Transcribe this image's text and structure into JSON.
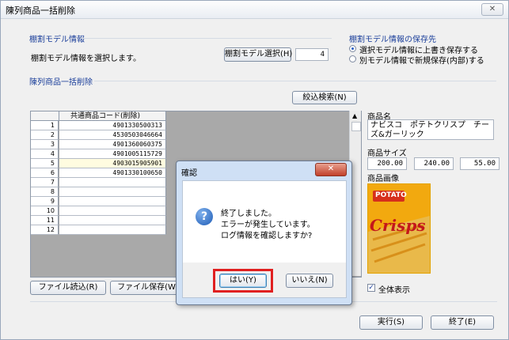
{
  "window": {
    "title": "陳列商品一括削除",
    "close_glyph": "✕"
  },
  "model_info": {
    "group_title": "棚割モデル情報",
    "description": "棚割モデル情報を選択します。",
    "select_button": "棚割モデル選択(H)",
    "count": "4"
  },
  "save_dest": {
    "group_title": "棚割モデル情報の保存先",
    "options": [
      {
        "label": "選択モデル情報に上書き保存する",
        "selected": true
      },
      {
        "label": "別モデル情報で新規保存(内部)する",
        "selected": false
      }
    ]
  },
  "bulk": {
    "group_title": "陳列商品一括削除",
    "filter_button": "絞込検索(N)",
    "grid": {
      "column_header": "共通商品コード(削除)",
      "rows": [
        {
          "no": "1",
          "code": "4901330500313"
        },
        {
          "no": "2",
          "code": "4530503046664"
        },
        {
          "no": "3",
          "code": "4901360060375"
        },
        {
          "no": "4",
          "code": "4901005115729"
        },
        {
          "no": "5",
          "code": "4903015905901"
        },
        {
          "no": "6",
          "code": "4901330100650"
        },
        {
          "no": "7",
          "code": ""
        },
        {
          "no": "8",
          "code": ""
        },
        {
          "no": "9",
          "code": ""
        },
        {
          "no": "10",
          "code": ""
        },
        {
          "no": "11",
          "code": ""
        },
        {
          "no": "12",
          "code": ""
        }
      ]
    }
  },
  "product": {
    "name_label": "商品名",
    "name_value": "ナビスコ　ポテトクリスプ　チーズ&ガーリック",
    "size_label": "商品サイズ",
    "size_values": [
      "200.00",
      "240.00",
      "55.00"
    ],
    "image_label": "商品画像",
    "image_text_top": "POTATO",
    "image_text_main": "Crisps"
  },
  "footer": {
    "load_button": "ファイル読込(R)",
    "save_button": "ファイル保存(W)",
    "show_all_label": "全体表示",
    "show_all_checked": true,
    "run_button": "実行(S)",
    "exit_button": "終了(E)"
  },
  "dialog": {
    "title": "確認",
    "icon": "?",
    "lines": [
      "終了しました。",
      "エラーが発生しています。",
      "ログ情報を確認しますか?"
    ],
    "yes_button": "はい(Y)",
    "no_button": "いいえ(N)",
    "highlight_color": "#e02020"
  },
  "colors": {
    "group_title": "#1a3e9a",
    "selected_row": "#fffce0"
  }
}
